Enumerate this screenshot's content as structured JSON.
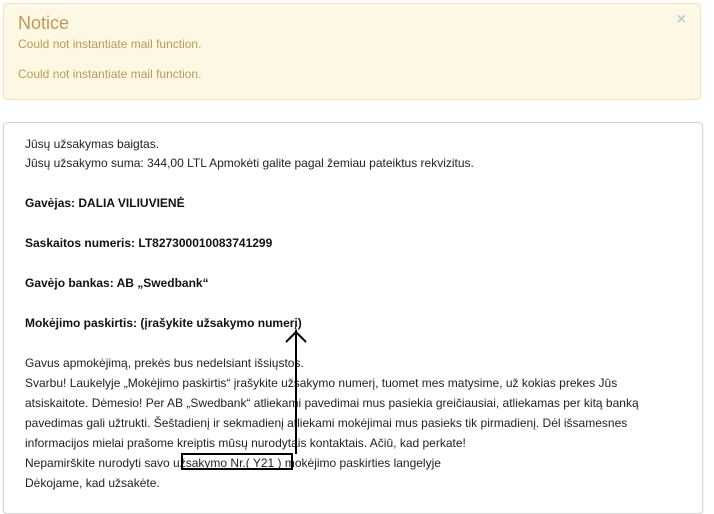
{
  "notice": {
    "title": "Notice",
    "close_glyph": "×",
    "messages": [
      "Could not instantiate mail function.",
      "Could not instantiate mail function."
    ]
  },
  "order": {
    "completed": "Jūsų užsakymas baigtas.",
    "sum_line": "Jūsų užsakymo suma: 344,00 LTL Apmokėti galite pagal žemiau pateiktus rekvizitus.",
    "recipient": "Gavėjas: DALIA VILIUVIENĖ",
    "account": "Saskaitos numeris: LT827300010083741299",
    "bank": "Gavėjo bankas: AB „Swedbank“",
    "purpose": "Mokėjimo paskirtis: (įrašykite užsakymo numerį)",
    "body_lines": [
      "Gavus apmokėjimą, prekės bus nedelsiant išsiųstos.",
      "Svarbu! Laukelyje „Mokėjimo paskirtis“ įrašykite užsakymo numerį, tuomet mes matysime, už kokias prekes Jūs",
      "atsiskaitote. Dėmesio! Per AB „Swedbank“ atliekami pavedimai mus pasiekia greičiausiai, atliekamas per kitą banką",
      "pavedimas gali užtrukti. Šeštadienį ir sekmadienį atliekami mokėjimai mus pasieks tik pirmadienį. Dėl išsamesnes",
      "informacijos mielai prašome kreiptis mūsų nurodytais kontaktais. Ačiū, kad perkate!",
      "Nepamirškite nurodyti savo užsakymo Nr.( Y21 ) mokėjimo paskirties langelyje",
      "Dėkojame, kad užsakėte."
    ]
  },
  "colors": {
    "notice_bg": "#fcf8e3",
    "notice_text": "#c09853",
    "annotation": "#000000"
  }
}
